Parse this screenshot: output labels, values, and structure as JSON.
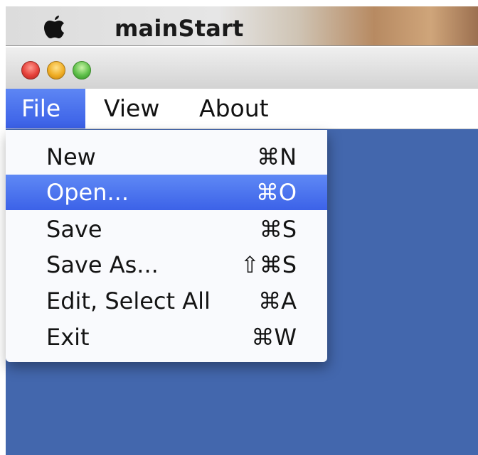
{
  "system_bar": {
    "apple_icon": "apple-icon",
    "app_name": "mainStart"
  },
  "window": {
    "buttons": [
      "close",
      "minimize",
      "zoom"
    ]
  },
  "menu": {
    "items": [
      {
        "label": "File",
        "active": true
      },
      {
        "label": "View",
        "active": false
      },
      {
        "label": "About",
        "active": false
      }
    ]
  },
  "dropdown": {
    "items": [
      {
        "label": "New",
        "shortcut": "⌘N",
        "highlighted": false
      },
      {
        "label": "Open...",
        "shortcut": "⌘O",
        "highlighted": true
      },
      {
        "label": "Save",
        "shortcut": "⌘S",
        "highlighted": false
      },
      {
        "label": "Save As...",
        "shortcut": "⇧⌘S",
        "highlighted": false
      },
      {
        "label": "Edit, Select All",
        "shortcut": "⌘A",
        "highlighted": false
      },
      {
        "label": "Exit",
        "shortcut": "⌘W",
        "highlighted": false
      }
    ]
  },
  "colors": {
    "content_background": "#4367ad",
    "highlight": "#4a72ee"
  }
}
